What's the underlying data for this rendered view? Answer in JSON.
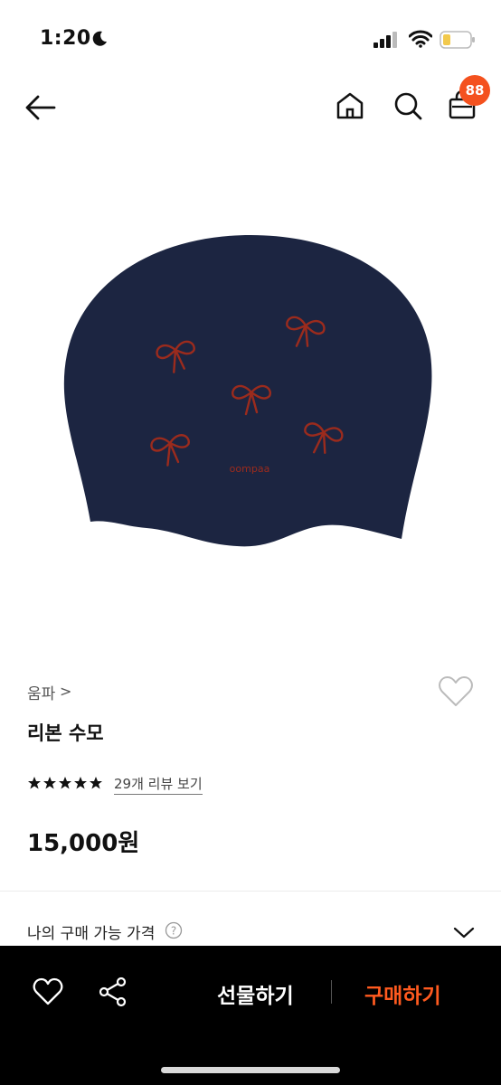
{
  "status_bar": {
    "time": "1:20",
    "icons": [
      "moon-icon",
      "signal-icon",
      "wifi-icon",
      "battery-icon"
    ]
  },
  "header": {
    "icons": [
      "back-arrow-icon",
      "home-icon",
      "search-icon",
      "cart-icon"
    ],
    "cart_badge": "88"
  },
  "product": {
    "image_subject": "navy swim cap with red ribbon bows",
    "cap_logo_text": "oompaa",
    "brand": "움파",
    "brand_chevron": ">",
    "name": "리본 수모",
    "rating_stars": 5,
    "reviews_link": "29개 리뷰 보기",
    "price": "15,000원",
    "available_price_label": "나의 구매 가능 가격",
    "help_symbol": "?"
  },
  "bottom_bar": {
    "gift_label": "선물하기",
    "buy_label": "구매하기"
  },
  "colors": {
    "accent": "#ff5a1f",
    "badge": "#f4511e",
    "cap": "#1c2541",
    "bow": "#9b2b1d",
    "bottom_bar_bg": "#000000"
  }
}
